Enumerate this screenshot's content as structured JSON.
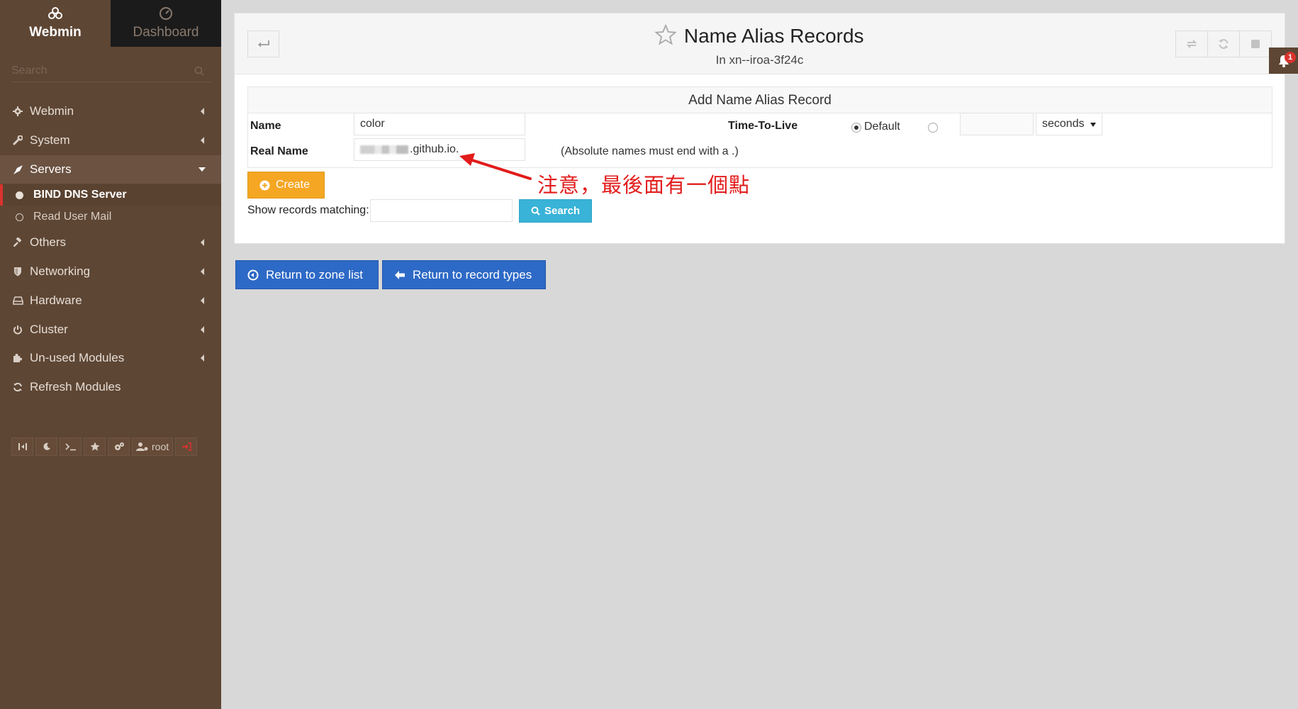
{
  "sidebar": {
    "tabs": [
      {
        "label": "Webmin",
        "icon": "webmin-logo-icon"
      },
      {
        "label": "Dashboard",
        "icon": "dashboard-icon"
      }
    ],
    "search_placeholder": "Search",
    "items": [
      {
        "label": "Webmin",
        "icon": "gear-icon"
      },
      {
        "label": "System",
        "icon": "wrench-icon"
      },
      {
        "label": "Servers",
        "icon": "rocket-icon"
      },
      {
        "label": "Others",
        "icon": "gavel-icon"
      },
      {
        "label": "Networking",
        "icon": "shield-icon"
      },
      {
        "label": "Hardware",
        "icon": "hdd-icon"
      },
      {
        "label": "Cluster",
        "icon": "power-icon"
      },
      {
        "label": "Un-used Modules",
        "icon": "puzzle-icon"
      },
      {
        "label": "Refresh Modules",
        "icon": "refresh-icon"
      }
    ],
    "subitems": [
      {
        "label": "BIND DNS Server",
        "active": true
      },
      {
        "label": "Read User Mail",
        "active": false
      }
    ],
    "toolbar": {
      "user_label": "root"
    }
  },
  "header": {
    "title": "Name Alias Records",
    "subtitle": "In xn--iroa-3f24c"
  },
  "form": {
    "heading": "Add Name Alias Record",
    "name_label": "Name",
    "name_value": "color",
    "realname_label": "Real Name",
    "realname_value": ".github.io.",
    "realname_hint": "(Absolute names must end with a .)",
    "ttl_label": "Time-To-Live",
    "ttl_default_label": "Default",
    "ttl_value": "",
    "ttl_unit": "seconds",
    "create_label": "Create",
    "match_label": "Show records matching:",
    "match_value": "",
    "search_label": "Search"
  },
  "annotation": {
    "text": "注意，最後面有一個點"
  },
  "footer": {
    "zone_list_label": "Return to zone list",
    "record_types_label": "Return to record types"
  },
  "notifications": {
    "count": "1"
  },
  "colors": {
    "sidebar_bg": "#5e4634",
    "create_button": "#f5a623",
    "search_button": "#39b3d7",
    "nav_button": "#2d69c6",
    "annotation": "#e21b1b"
  }
}
